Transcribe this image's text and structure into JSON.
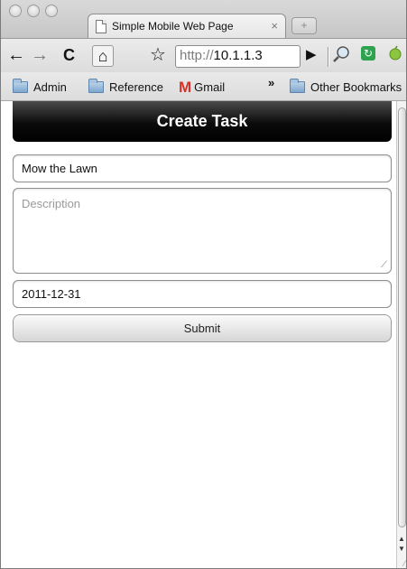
{
  "browser": {
    "tab_title": "Simple Mobile Web Page",
    "tab_close": "×",
    "new_tab": "+",
    "url_scheme": "http://",
    "url_host": "10.1.1.3",
    "overflow_chevron": "»",
    "bookmarks": [
      {
        "label": "Admin",
        "icon": "folder-icon"
      },
      {
        "label": "Reference",
        "icon": "folder-icon"
      },
      {
        "label": "Gmail",
        "icon": "gmail-icon"
      },
      {
        "label": "Other Bookmarks",
        "icon": "folder-icon"
      }
    ],
    "toolbar_icons": [
      "back-icon",
      "forward-icon",
      "reload-icon",
      "home-icon",
      "star-icon",
      "go-icon",
      "search-icon",
      "extension-icon",
      "leaf-icon"
    ]
  },
  "page": {
    "header_title": "Create Task",
    "task_title_value": "Mow the Lawn",
    "description_placeholder": "Description",
    "date_value": "2011-12-31",
    "submit_label": "Submit"
  },
  "colors": {
    "header_bg": "#000000",
    "header_text": "#ffffff",
    "gmail_red": "#d5322a"
  }
}
